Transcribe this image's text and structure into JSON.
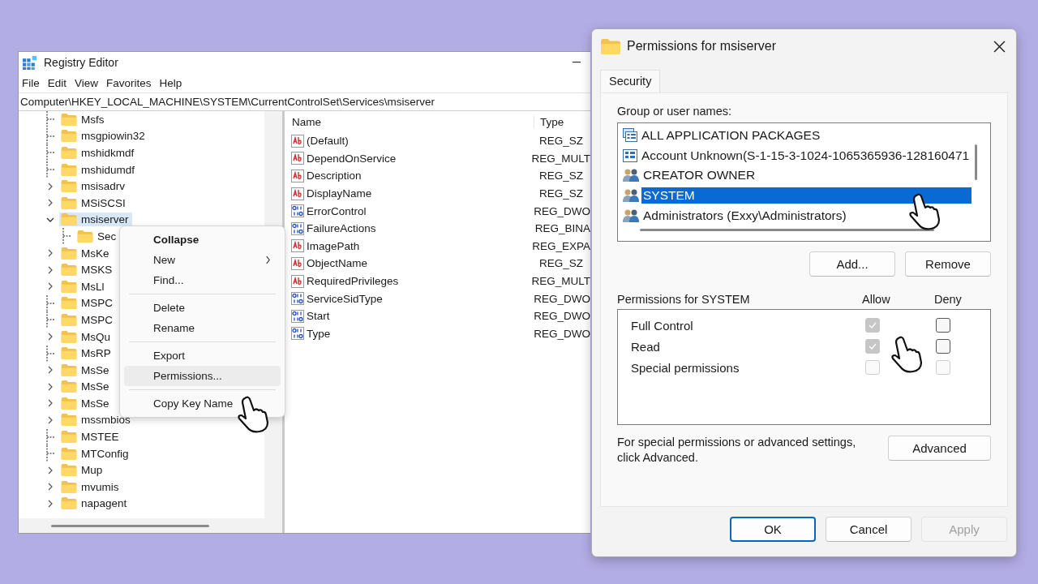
{
  "registry_editor": {
    "title": "Registry Editor",
    "menu": [
      "File",
      "Edit",
      "View",
      "Favorites",
      "Help"
    ],
    "address": "Computer\\HKEY_LOCAL_MACHINE\\SYSTEM\\CurrentControlSet\\Services\\msiserver",
    "tree": [
      {
        "label": "Msfs",
        "kind": "leaf",
        "selected": false
      },
      {
        "label": "msgpiowin32",
        "kind": "leaf",
        "selected": false
      },
      {
        "label": "mshidkmdf",
        "kind": "leaf",
        "selected": false
      },
      {
        "label": "mshidumdf",
        "kind": "leaf",
        "selected": false
      },
      {
        "label": "msisadrv",
        "kind": "collapsed",
        "selected": false
      },
      {
        "label": "MSiSCSI",
        "kind": "collapsed",
        "selected": false
      },
      {
        "label": "msiserver",
        "kind": "expanded",
        "selected": true,
        "children": [
          {
            "label": "Sec",
            "kind": "leaf",
            "selected": false
          }
        ]
      },
      {
        "label": "MsKe",
        "kind": "collapsed",
        "selected": false
      },
      {
        "label": "MSKS",
        "kind": "collapsed",
        "selected": false
      },
      {
        "label": "MsLl",
        "kind": "collapsed",
        "selected": false
      },
      {
        "label": "MSPC",
        "kind": "leaf",
        "selected": false
      },
      {
        "label": "MSPC",
        "kind": "leaf",
        "selected": false
      },
      {
        "label": "MsQu",
        "kind": "collapsed",
        "selected": false
      },
      {
        "label": "MsRP",
        "kind": "leaf",
        "selected": false
      },
      {
        "label": "MsSe",
        "kind": "collapsed",
        "selected": false
      },
      {
        "label": "MsSe",
        "kind": "collapsed",
        "selected": false
      },
      {
        "label": "MsSe",
        "kind": "collapsed",
        "selected": false
      },
      {
        "label": "mssmbios",
        "kind": "collapsed",
        "selected": false
      },
      {
        "label": "MSTEE",
        "kind": "leaf",
        "selected": false
      },
      {
        "label": "MTConfig",
        "kind": "leaf",
        "selected": false
      },
      {
        "label": "Mup",
        "kind": "collapsed",
        "selected": false
      },
      {
        "label": "mvumis",
        "kind": "collapsed",
        "selected": false
      },
      {
        "label": "napagent",
        "kind": "collapsed",
        "selected": false
      }
    ],
    "columns": [
      "Name",
      "Type"
    ],
    "values": [
      {
        "name": "(Default)",
        "type": "REG_SZ",
        "kind": "string"
      },
      {
        "name": "DependOnService",
        "type": "REG_MULT",
        "kind": "string"
      },
      {
        "name": "Description",
        "type": "REG_SZ",
        "kind": "string"
      },
      {
        "name": "DisplayName",
        "type": "REG_SZ",
        "kind": "string"
      },
      {
        "name": "ErrorControl",
        "type": "REG_DWO",
        "kind": "binary"
      },
      {
        "name": "FailureActions",
        "type": "REG_BINA",
        "kind": "binary"
      },
      {
        "name": "ImagePath",
        "type": "REG_EXPA",
        "kind": "string"
      },
      {
        "name": "ObjectName",
        "type": "REG_SZ",
        "kind": "string"
      },
      {
        "name": "RequiredPrivileges",
        "type": "REG_MULT",
        "kind": "string"
      },
      {
        "name": "ServiceSidType",
        "type": "REG_DWO",
        "kind": "binary"
      },
      {
        "name": "Start",
        "type": "REG_DWO",
        "kind": "binary"
      },
      {
        "name": "Type",
        "type": "REG_DWO",
        "kind": "binary"
      }
    ]
  },
  "context_menu": [
    {
      "kind": "item",
      "label": "Collapse",
      "default": true,
      "submenu": false,
      "highlighted": false
    },
    {
      "kind": "item",
      "label": "New",
      "default": false,
      "submenu": true,
      "highlighted": false
    },
    {
      "kind": "item",
      "label": "Find...",
      "default": false,
      "submenu": false,
      "highlighted": false
    },
    {
      "kind": "separator"
    },
    {
      "kind": "item",
      "label": "Delete",
      "default": false,
      "submenu": false,
      "highlighted": false
    },
    {
      "kind": "item",
      "label": "Rename",
      "default": false,
      "submenu": false,
      "highlighted": false
    },
    {
      "kind": "separator"
    },
    {
      "kind": "item",
      "label": "Export",
      "default": false,
      "submenu": false,
      "highlighted": false
    },
    {
      "kind": "item",
      "label": "Permissions...",
      "default": false,
      "submenu": false,
      "highlighted": true
    },
    {
      "kind": "separator"
    },
    {
      "kind": "item",
      "label": "Copy Key Name",
      "default": false,
      "submenu": false,
      "highlighted": false
    }
  ],
  "permissions_dialog": {
    "title": "Permissions for msiserver",
    "tabs": [
      {
        "label": "Security",
        "selected": true
      }
    ],
    "group_label": "Group or user names:",
    "principals": [
      {
        "name": "ALL APPLICATION PACKAGES",
        "kind": "package",
        "selected": false
      },
      {
        "name": "Account Unknown(S-1-15-3-1024-1065365936-128160471",
        "kind": "account",
        "selected": false
      },
      {
        "name": "CREATOR OWNER",
        "kind": "group",
        "selected": false
      },
      {
        "name": "SYSTEM",
        "kind": "group",
        "selected": true
      },
      {
        "name": "Administrators (Exxy\\Administrators)",
        "kind": "group",
        "selected": false
      }
    ],
    "principal_buttons": [
      "Add...",
      "Remove"
    ],
    "permissions_label": "Permissions for SYSTEM",
    "allow_header": "Allow",
    "deny_header": "Deny",
    "permissions": [
      {
        "name": "Full Control",
        "allow": {
          "checked": true,
          "disabled": true
        },
        "deny": {
          "checked": false,
          "disabled": false
        }
      },
      {
        "name": "Read",
        "allow": {
          "checked": true,
          "disabled": true
        },
        "deny": {
          "checked": false,
          "disabled": false
        }
      },
      {
        "name": "Special permissions",
        "allow": {
          "checked": false,
          "disabled": true
        },
        "deny": {
          "checked": false,
          "disabled": true
        }
      }
    ],
    "advanced_note": "For special permissions or advanced settings, click Advanced.",
    "advanced_button": "Advanced",
    "footer_buttons": [
      {
        "label": "OK",
        "default": true,
        "disabled": false
      },
      {
        "label": "Cancel",
        "default": false,
        "disabled": false
      },
      {
        "label": "Apply",
        "default": false,
        "disabled": true
      }
    ]
  }
}
